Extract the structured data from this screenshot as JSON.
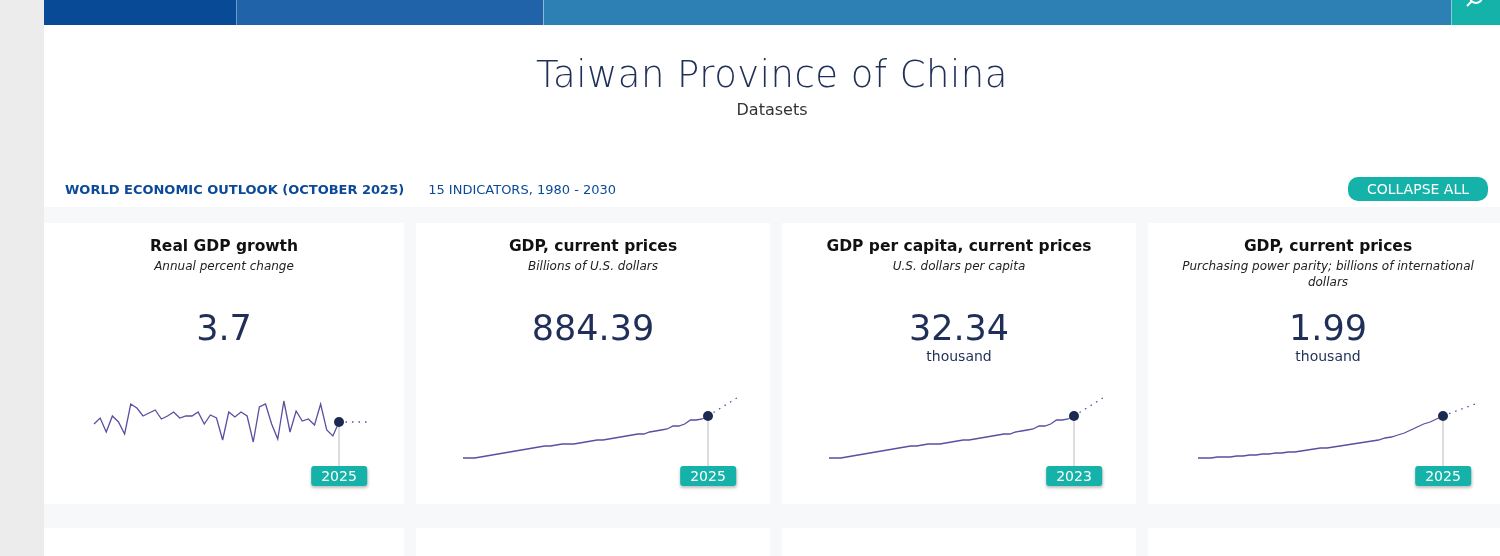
{
  "page": {
    "title": "Taiwan Province of China",
    "subtitle": "Datasets"
  },
  "dataset": {
    "name": "WORLD ECONOMIC OUTLOOK (OCTOBER 2025)",
    "info": "15 INDICATORS, 1980 - 2030",
    "button": "COLLAPSE ALL"
  },
  "cards": [
    {
      "title": "Real GDP growth",
      "unit": "Annual percent change",
      "value": "3.7",
      "year": "2025",
      "kind": "volatile"
    },
    {
      "title": "GDP, current prices",
      "unit": "Billions of U.S. dollars",
      "value": "884.39",
      "year": "2025",
      "kind": "growth"
    },
    {
      "title": "GDP per capita, current prices",
      "unit": "U.S. dollars per capita",
      "value": "32.34",
      "scale": "thousand",
      "year": "2023",
      "kind": "growth"
    },
    {
      "title": "GDP, current prices",
      "unit": "Purchasing power parity; billions of international dollars",
      "value": "1.99",
      "scale": "thousand",
      "year": "2025",
      "kind": "smooth"
    }
  ]
}
